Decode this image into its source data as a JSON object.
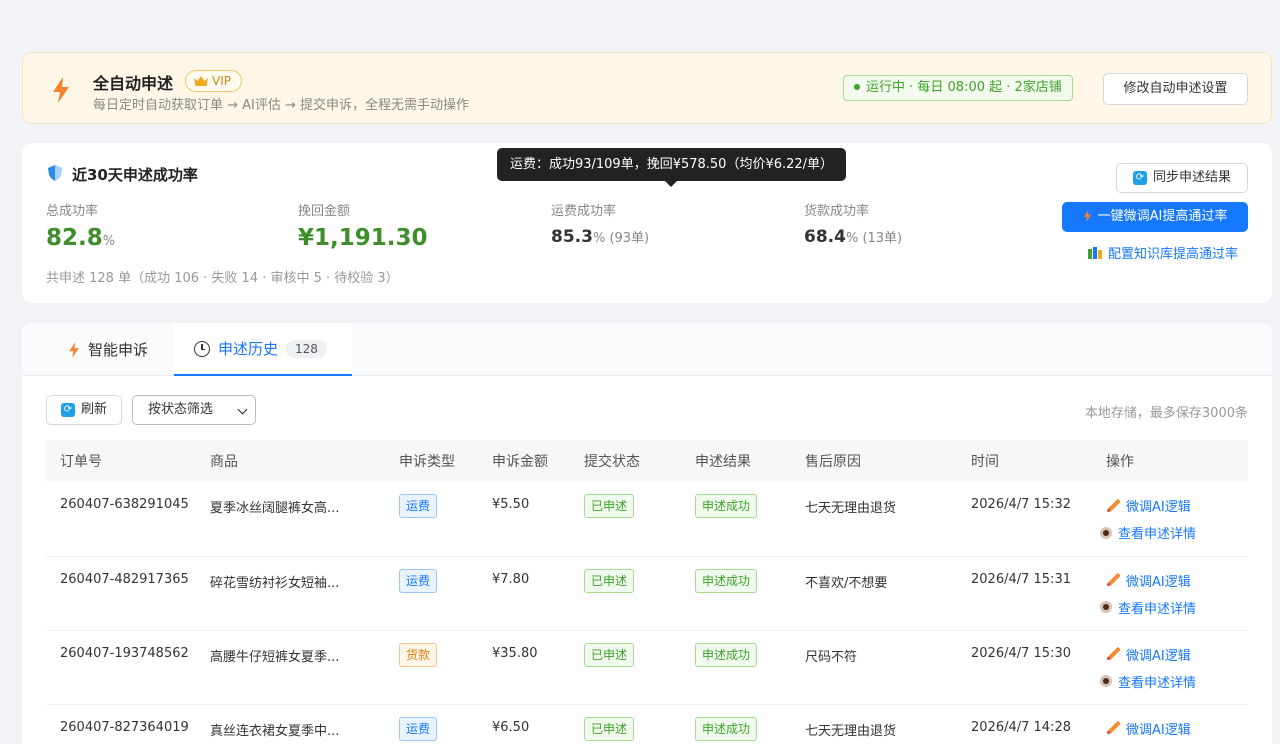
{
  "banner": {
    "title": "全自动申述",
    "vip": "VIP",
    "subtitle": "每日定时自动获取订单 → AI评估 → 提交申诉，全程无需手动操作",
    "status": "运行中 · 每日 08:00 起 · 2家店铺",
    "modify_label": "修改自动申述设置"
  },
  "stats": {
    "title": "近30天申述成功率",
    "total_rate_label": "总成功率",
    "total_rate_value": "82.8",
    "total_rate_unit": "%",
    "recovered_label": "挽回金额",
    "recovered_value": "¥1,191.30",
    "freight_label": "运费成功率",
    "freight_value": "85.3",
    "freight_extra": "% (93单)",
    "goods_label": "货款成功率",
    "goods_value": "68.4",
    "goods_extra": "% (13单)",
    "summary": "共申述 128 单（成功 106 · 失败 14 · 审核中 5 · 待校验 3）",
    "tooltip": "运费：成功93/109单，挽回¥578.50（均价¥6.22/单）",
    "sync_label": "同步申述结果",
    "ai_label": "一键微调AI提高通过率",
    "kb_label": "配置知识库提高通过率"
  },
  "tabs": {
    "smart": "智能申诉",
    "history": "申述历史",
    "history_count": "128"
  },
  "toolbar": {
    "refresh_label": "刷新",
    "filter_label": "按状态筛选",
    "note": "本地存储，最多保存3000条"
  },
  "table": {
    "headers": [
      "订单号",
      "商品",
      "申诉类型",
      "申诉金额",
      "提交状态",
      "申述结果",
      "售后原因",
      "时间",
      "操作"
    ],
    "rows": [
      {
        "order": "260407-638291045",
        "product": "夏季冰丝阔腿裤女高...",
        "type": "运费",
        "amount": "¥5.50",
        "submit": "已申述",
        "result": "申述成功",
        "reason": "七天无理由退货",
        "time": "2026/4/7 15:32"
      },
      {
        "order": "260407-482917365",
        "product": "碎花雪纺衬衫女短袖...",
        "type": "运费",
        "amount": "¥7.80",
        "submit": "已申述",
        "result": "申述成功",
        "reason": "不喜欢/不想要",
        "time": "2026/4/7 15:31"
      },
      {
        "order": "260407-193748562",
        "product": "高腰牛仔短裤女夏季...",
        "type": "货款",
        "amount": "¥35.80",
        "submit": "已申述",
        "result": "申述成功",
        "reason": "尺码不符",
        "time": "2026/4/7 15:30"
      },
      {
        "order": "260407-827364019",
        "product": "真丝连衣裙女夏季中...",
        "type": "运费",
        "amount": "¥6.50",
        "submit": "已申述",
        "result": "申述成功",
        "reason": "七天无理由退货",
        "time": "2026/4/7 14:28"
      }
    ],
    "op_edit": "微调AI逻辑",
    "op_view": "查看申述详情"
  }
}
